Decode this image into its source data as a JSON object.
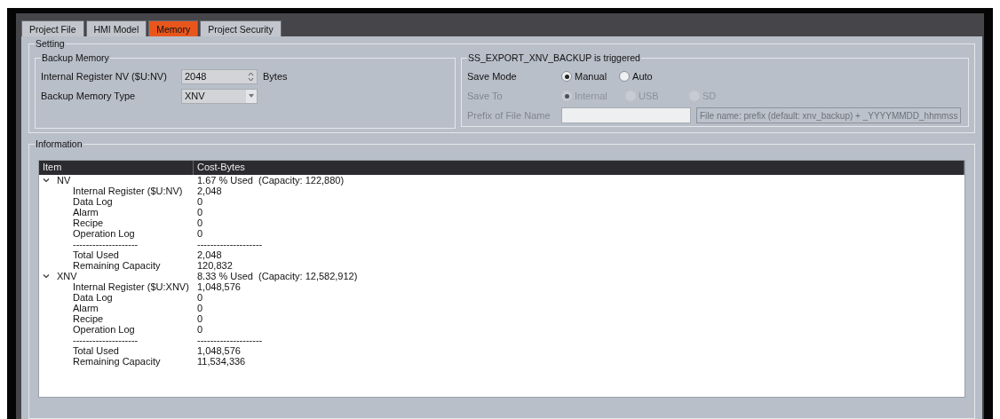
{
  "tabs": [
    {
      "label": "Project File",
      "selected": false
    },
    {
      "label": "HMI Model",
      "selected": false
    },
    {
      "label": "Memory",
      "selected": true
    },
    {
      "label": "Project Security",
      "selected": false
    }
  ],
  "setting": {
    "title": "Setting",
    "backup_memory": {
      "title": "Backup Memory",
      "internal_register": {
        "label": "Internal Register NV ($U:NV)",
        "value": "2048",
        "unit": "Bytes"
      },
      "backup_memory_type": {
        "label": "Backup Memory Type",
        "value": "XNV"
      }
    },
    "export": {
      "title": "SS_EXPORT_XNV_BACKUP is triggered",
      "save_mode": {
        "label": "Save Mode",
        "disabled": false,
        "options": [
          {
            "label": "Manual",
            "selected": true
          },
          {
            "label": "Auto",
            "selected": false
          }
        ]
      },
      "save_to": {
        "label": "Save To",
        "disabled": true,
        "options": [
          {
            "label": "Internal",
            "selected": true
          },
          {
            "label": "USB",
            "selected": false
          },
          {
            "label": "SD",
            "selected": false
          }
        ]
      },
      "prefix": {
        "label": "Prefix of File Name",
        "disabled": true,
        "hint": "File name: prefix (default: xnv_backup) + _YYYYMMDD_hhmmss"
      }
    }
  },
  "information": {
    "title": "Information",
    "columns": [
      "Item",
      "Cost-Bytes"
    ],
    "groups": [
      {
        "name": "NV",
        "expanded": true,
        "value": "1.67 % Used  (Capacity: 122,880)",
        "children": [
          {
            "item": "Internal Register ($U:NV)",
            "value": "2,048"
          },
          {
            "item": "Data Log",
            "value": "0"
          },
          {
            "item": "Alarm",
            "value": "0"
          },
          {
            "item": "Recipe",
            "value": "0"
          },
          {
            "item": "Operation Log",
            "value": "0"
          },
          {
            "item": "--------------------",
            "value": "--------------------"
          },
          {
            "item": "Total Used",
            "value": "2,048"
          },
          {
            "item": "Remaining Capacity",
            "value": "120,832"
          }
        ]
      },
      {
        "name": "XNV",
        "expanded": true,
        "value": "8.33 % Used  (Capacity: 12,582,912)",
        "children": [
          {
            "item": "Internal Register ($U:XNV)",
            "value": "1,048,576"
          },
          {
            "item": "Data Log",
            "value": "0"
          },
          {
            "item": "Alarm",
            "value": "0"
          },
          {
            "item": "Recipe",
            "value": "0"
          },
          {
            "item": "Operation Log",
            "value": "0"
          },
          {
            "item": "--------------------",
            "value": "--------------------"
          },
          {
            "item": "Total Used",
            "value": "1,048,576"
          },
          {
            "item": "Remaining Capacity",
            "value": "11,534,336"
          }
        ]
      }
    ]
  }
}
